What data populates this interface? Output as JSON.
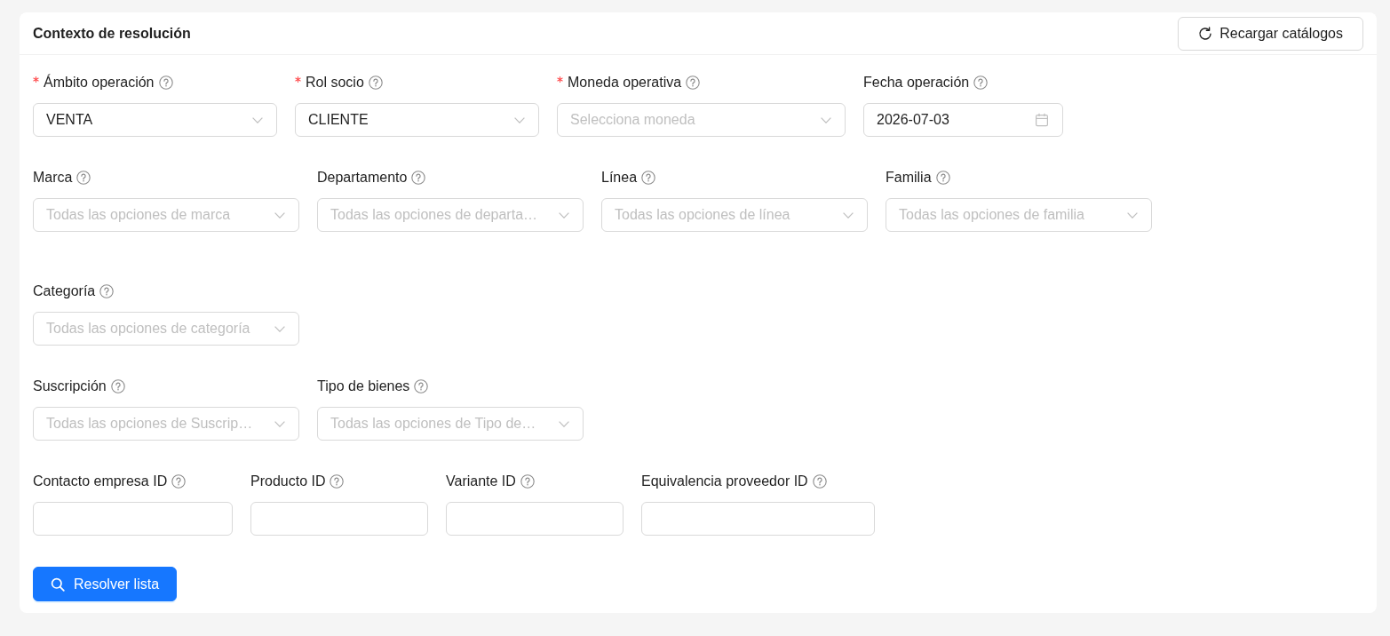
{
  "card": {
    "title": "Contexto de resolución",
    "reload_button": {
      "label": "Recargar catálogos"
    }
  },
  "groups": [
    [
      {
        "label": "Ámbito operación",
        "required": true,
        "kind": "select",
        "value": "VENTA"
      },
      {
        "label": "Rol socio",
        "required": true,
        "kind": "select",
        "value": "CLIENTE"
      },
      {
        "label": "Moneda operativa",
        "required": true,
        "kind": "select",
        "placeholder": "Selecciona moneda"
      },
      {
        "label": "Fecha operación",
        "required": false,
        "kind": "date",
        "value": "2026-07-03"
      }
    ],
    [
      {
        "label": "Marca",
        "required": false,
        "kind": "select",
        "placeholder": "Todas las opciones de marca"
      },
      {
        "label": "Departamento",
        "required": false,
        "kind": "select",
        "placeholder": "Todas las opciones de departa…"
      },
      {
        "label": "Línea",
        "required": false,
        "kind": "select",
        "placeholder": "Todas las opciones de línea"
      },
      {
        "label": "Familia",
        "required": false,
        "kind": "select",
        "placeholder": "Todas las opciones de familia"
      },
      {
        "label": "Categoría",
        "required": false,
        "kind": "select",
        "placeholder": "Todas las opciones de categoría"
      }
    ],
    [
      {
        "label": "Suscripción",
        "required": false,
        "kind": "select",
        "placeholder": "Todas las opciones de Suscrip…"
      },
      {
        "label": "Tipo de bienes",
        "required": false,
        "kind": "select",
        "placeholder": "Todas las opciones de Tipo de…"
      }
    ],
    [
      {
        "label": "Contacto empresa ID",
        "required": false,
        "kind": "input"
      },
      {
        "label": "Producto ID",
        "required": false,
        "kind": "input"
      },
      {
        "label": "Variante ID",
        "required": false,
        "kind": "input"
      },
      {
        "label": "Equivalencia proveedor ID",
        "required": false,
        "kind": "input"
      }
    ]
  ],
  "submit_button": {
    "label": "Resolver lista"
  }
}
